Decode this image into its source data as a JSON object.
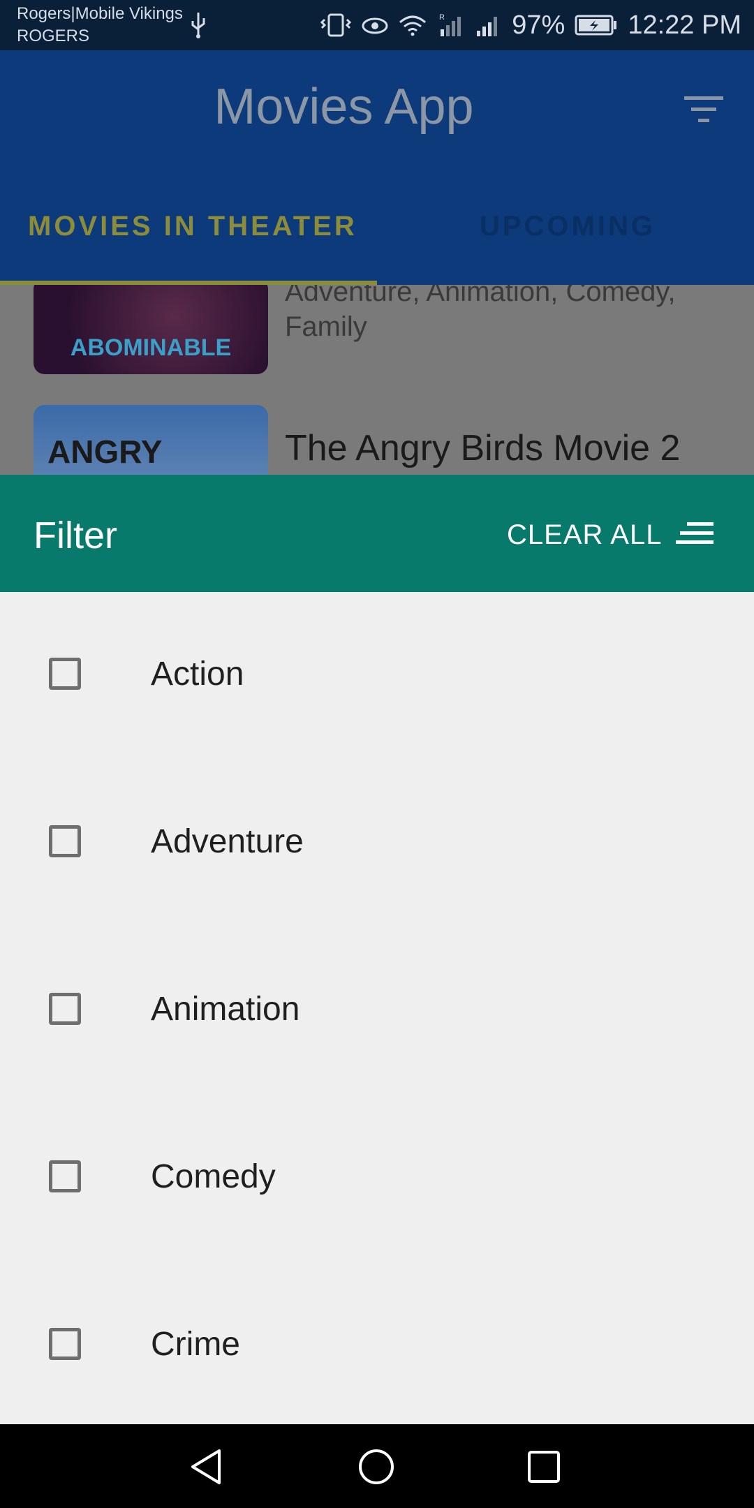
{
  "status_bar": {
    "carrier_line1": "Rogers|Mobile Vikings",
    "carrier_line2": "ROGERS",
    "battery": "97%",
    "time": "12:22 PM",
    "icons": [
      "usb-icon",
      "vibrate-icon",
      "eye-comfort-icon",
      "wifi-icon",
      "roaming-signal-icon",
      "signal-icon",
      "battery-charging-icon"
    ]
  },
  "app_bar": {
    "title": "Movies App",
    "tabs": [
      {
        "label": "MOVIES IN THEATER",
        "selected": true
      },
      {
        "label": "UPCOMING",
        "selected": false
      }
    ]
  },
  "movie_list": {
    "items": [
      {
        "poster_text": "ABOMINABLE",
        "genres_line1": "Adventure, Animation, Comedy,",
        "genres_line2": "Family"
      },
      {
        "poster_text": "ANGRY BIRDS",
        "title": "The Angry Birds Movie 2"
      }
    ]
  },
  "filter_sheet": {
    "title": "Filter",
    "clear_all_label": "CLEAR ALL",
    "options": [
      {
        "label": "Action",
        "checked": false
      },
      {
        "label": "Adventure",
        "checked": false
      },
      {
        "label": "Animation",
        "checked": false
      },
      {
        "label": "Comedy",
        "checked": false
      },
      {
        "label": "Crime",
        "checked": false
      }
    ]
  },
  "colors": {
    "sheet_header": "#077a6c",
    "sheet_body": "#efefef",
    "app_bar_dimmed": "#0c3a7a",
    "tab_indicator": "#8c8c3a"
  }
}
